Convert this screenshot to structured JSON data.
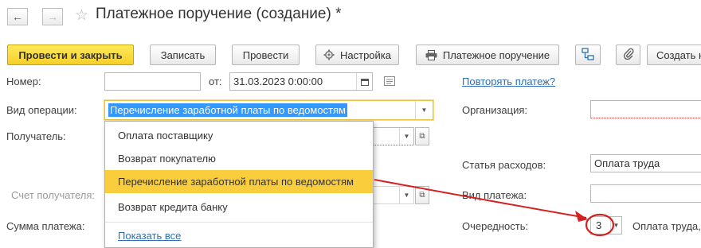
{
  "window": {
    "title": "Платежное поручение (создание) *"
  },
  "toolbar": {
    "post_close": "Провести и закрыть",
    "save": "Записать",
    "post": "Провести",
    "settings": "Настройка",
    "payment_order": "Платежное поручение",
    "create": "Создать на"
  },
  "form": {
    "number_label": "Номер:",
    "number_value": "",
    "from_label": "от:",
    "date_value": "31.03.2023  0:00:00",
    "repeat_link": "Повторять платеж?",
    "operation_label": "Вид операции:",
    "operation_value": "Перечисление заработной платы по ведомостям",
    "organization_label": "Организация:",
    "recipient_label": "Получатель:",
    "expense_label": "Статья расходов:",
    "expense_value": "Оплата труда",
    "account_label": "Счет получателя:",
    "payment_type_label": "Вид платежа:",
    "amount_label": "Сумма платежа:",
    "priority_label": "Очередность:",
    "priority_value": "3",
    "priority_desc": "Оплата труда,"
  },
  "dropdown": {
    "items": [
      "Оплата поставщику",
      "Возврат покупателю",
      "Перечисление заработной платы по ведомостям",
      "Возврат кредита банку"
    ],
    "selected_index": 2,
    "show_all": "Показать все"
  },
  "colors": {
    "primary_button": "#f5cf2a",
    "highlight": "#f9cd3c",
    "selection": "#3399ff",
    "link": "#2d6fb6",
    "annotation": "#d42020"
  }
}
